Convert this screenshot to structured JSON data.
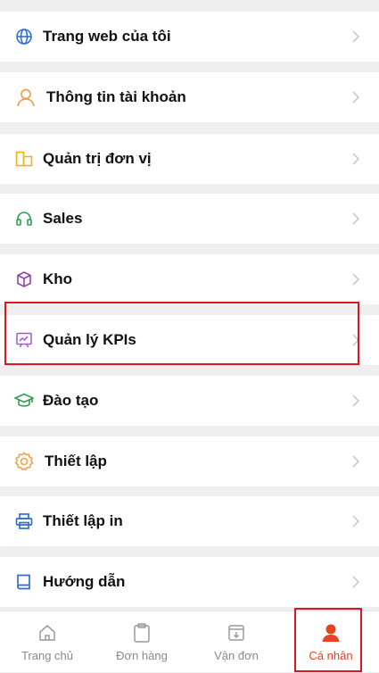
{
  "menu": {
    "items": [
      {
        "label": "Trang web của tôi",
        "icon": "globe-icon",
        "color": "#2f6fd6"
      },
      {
        "label": "Thông tin tài khoản",
        "icon": "user-icon",
        "color": "#f0a04b"
      },
      {
        "label": "Quản trị đơn vị",
        "icon": "building-icon",
        "color": "#f2b21b"
      },
      {
        "label": "Sales",
        "icon": "headset-icon",
        "color": "#2e9e4f"
      },
      {
        "label": "Kho",
        "icon": "box-icon",
        "color": "#8e44ad"
      },
      {
        "label": "Quản lý KPIs",
        "icon": "kpi-board-icon",
        "color": "#9b59d0"
      },
      {
        "label": "Đào tạo",
        "icon": "graduation-cap-icon",
        "color": "#2e9e4f"
      },
      {
        "label": "Thiết lập",
        "icon": "gear-icon",
        "color": "#f0a04b"
      },
      {
        "label": "Thiết lập in",
        "icon": "printer-icon",
        "color": "#2f6fd6"
      },
      {
        "label": "Hướng dẫn",
        "icon": "book-icon",
        "color": "#2f6fd6"
      }
    ]
  },
  "tabbar": {
    "tabs": [
      {
        "label": "Trang chủ",
        "icon": "home-icon"
      },
      {
        "label": "Đơn hàng",
        "icon": "clipboard-icon"
      },
      {
        "label": "Vận đơn",
        "icon": "download-box-icon"
      },
      {
        "label": "Cá nhân",
        "icon": "person-icon",
        "active": true
      }
    ],
    "active_color": "#e8431f",
    "inactive_color": "#8a8a8a"
  }
}
